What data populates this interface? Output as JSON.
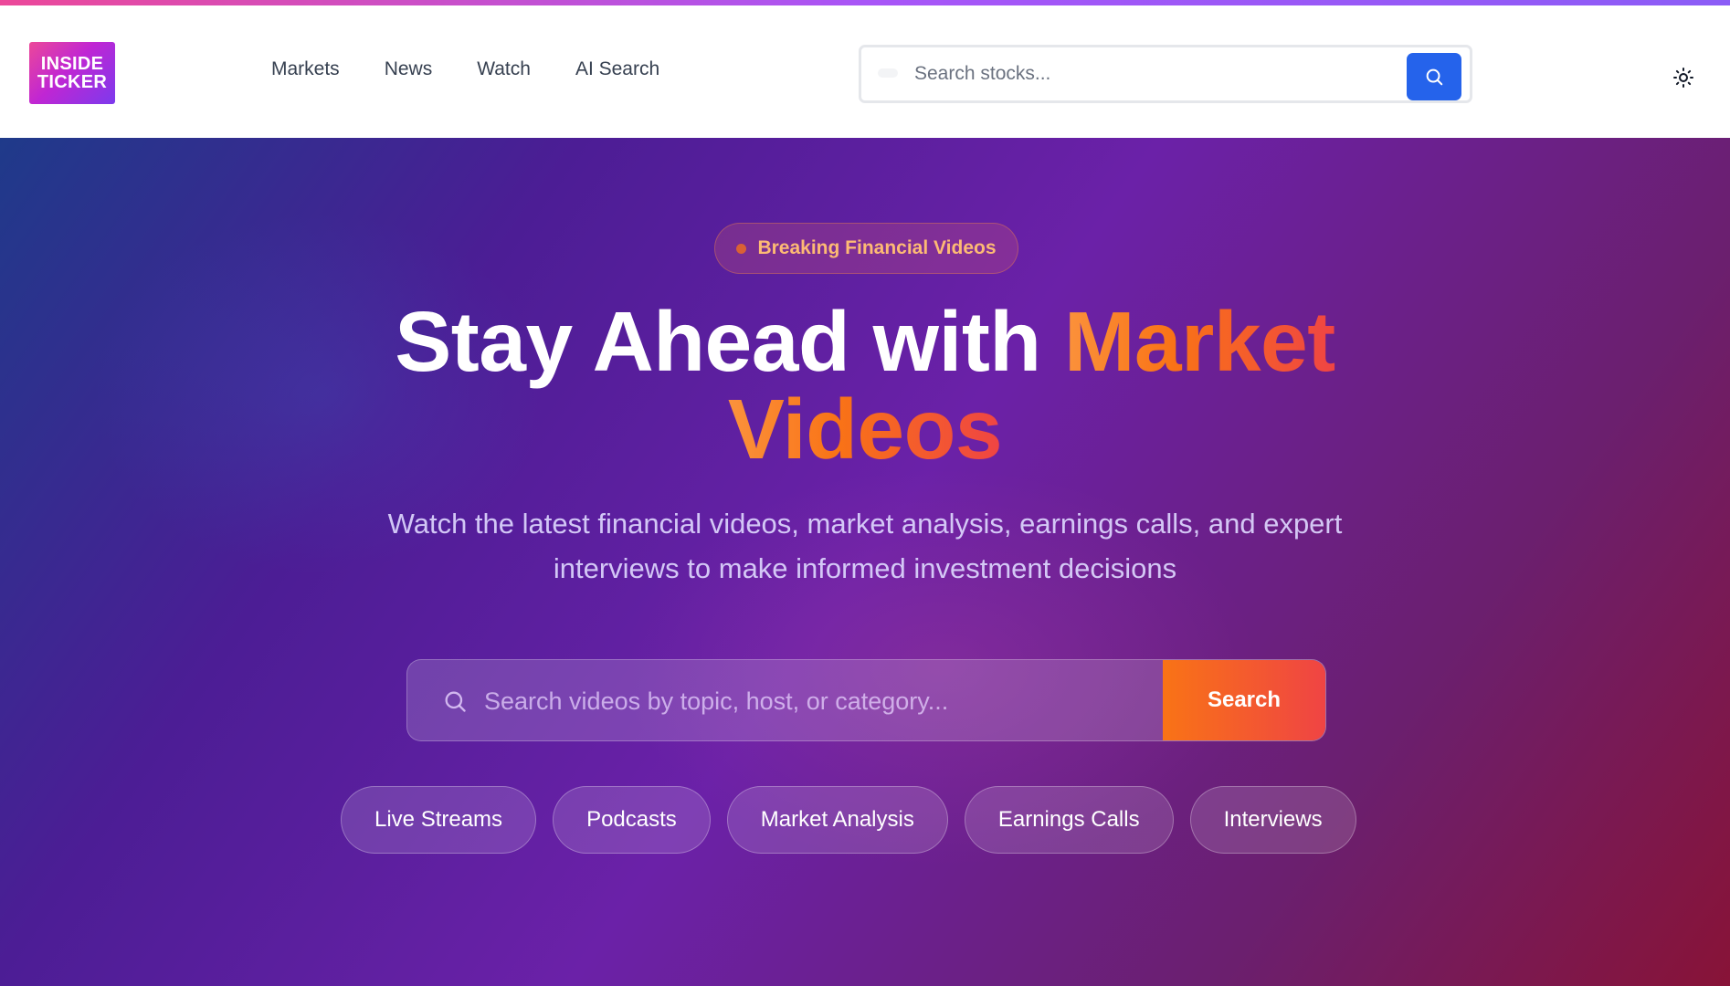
{
  "brand": {
    "logo_line1": "INSIDE",
    "logo_line2": "TICKER"
  },
  "nav": {
    "links": [
      {
        "label": "Markets"
      },
      {
        "label": "News"
      },
      {
        "label": "Watch"
      },
      {
        "label": "AI Search"
      }
    ]
  },
  "stock_search": {
    "placeholder": "Search stocks...",
    "button_icon": "search-icon"
  },
  "theme_toggle": {
    "icon": "sun-icon"
  },
  "hero": {
    "badge": "Breaking Financial Videos",
    "headline_plain": "Stay Ahead with ",
    "headline_accent_1": "Market",
    "headline_accent_2": "Videos",
    "subtext": "Watch the latest financial videos, market analysis, earnings calls, and expert interviews to make informed investment decisions",
    "search_placeholder": "Search videos by topic, host, or category...",
    "search_button": "Search",
    "chips": [
      {
        "label": "Live Streams"
      },
      {
        "label": "Podcasts"
      },
      {
        "label": "Market Analysis"
      },
      {
        "label": "Earnings Calls"
      },
      {
        "label": "Interviews"
      }
    ]
  },
  "colors": {
    "accent_orange": "#f97316",
    "primary_blue": "#2563eb",
    "hero_start": "#1f3a8a",
    "hero_end": "#881337"
  }
}
